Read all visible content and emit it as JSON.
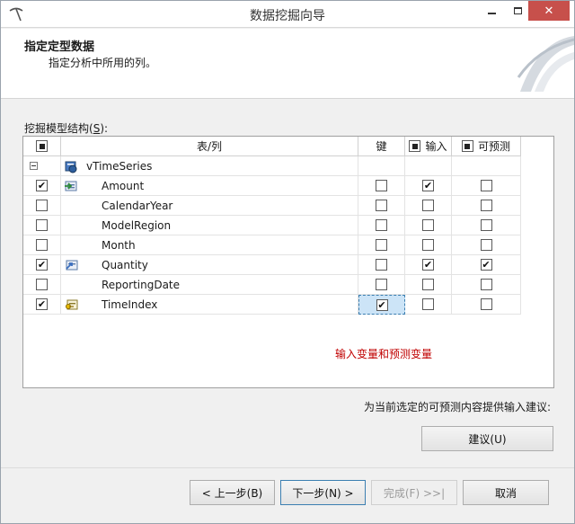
{
  "window": {
    "title": "数据挖掘向导"
  },
  "header": {
    "title": "指定定型数据",
    "subtitle": "指定分析中所用的列。"
  },
  "section": {
    "label_prefix": "挖掘模型结构(",
    "label_key": "S",
    "label_suffix": "):"
  },
  "grid": {
    "columns": {
      "table_column": "表/列",
      "key": "键",
      "input": "输入",
      "predictable": "可预测"
    },
    "table_name": "vTimeSeries",
    "rows": [
      {
        "name": "Amount",
        "selected": true,
        "key": false,
        "input": true,
        "predictable": false,
        "icon": "input-column-icon"
      },
      {
        "name": "CalendarYear",
        "selected": false,
        "key": false,
        "input": false,
        "predictable": false,
        "icon": ""
      },
      {
        "name": "ModelRegion",
        "selected": false,
        "key": false,
        "input": false,
        "predictable": false,
        "icon": ""
      },
      {
        "name": "Month",
        "selected": false,
        "key": false,
        "input": false,
        "predictable": false,
        "icon": ""
      },
      {
        "name": "Quantity",
        "selected": true,
        "key": false,
        "input": true,
        "predictable": true,
        "icon": "predict-column-icon"
      },
      {
        "name": "ReportingDate",
        "selected": false,
        "key": false,
        "input": false,
        "predictable": false,
        "icon": ""
      },
      {
        "name": "TimeIndex",
        "selected": true,
        "key": true,
        "input": false,
        "predictable": false,
        "icon": "key-column-icon"
      }
    ],
    "note": "输入变量和预测变量"
  },
  "suggest": {
    "hint": "为当前选定的可预测内容提供输入建议:",
    "button": "建议(U)"
  },
  "footer": {
    "back": "< 上一步(B)",
    "next": "下一步(N) >",
    "finish": "完成(F) >>|",
    "cancel": "取消"
  },
  "colors": {
    "accent": "#3c7fb1",
    "note": "#c00000",
    "close": "#c7504b"
  }
}
